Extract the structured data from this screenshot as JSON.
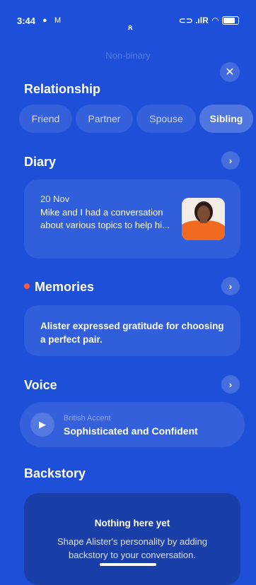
{
  "status_bar": {
    "time": "3:44",
    "right_text": "⊂⊃ .ılR"
  },
  "faded_value": "Non-binary",
  "relationship": {
    "heading": "Relationship",
    "options": [
      "Friend",
      "Partner",
      "Spouse",
      "Sibling"
    ],
    "selected": "Sibling"
  },
  "diary": {
    "heading": "Diary",
    "date": "20 Nov",
    "line1": "Mike and I had a conversation",
    "line2": "about various topics to help hi..."
  },
  "memories": {
    "heading": "Memories",
    "line1": "Alister expressed gratitude for choosing",
    "line2": "a perfect pair."
  },
  "voice": {
    "heading": "Voice",
    "accent": "British Accent",
    "name": "Sophisticated and Confident"
  },
  "backstory": {
    "heading": "Backstory",
    "empty_title": "Nothing here yet",
    "empty_line1": "Shape Alister's personality by adding",
    "empty_line2": "backstory to your conversation."
  },
  "colors": {
    "background": "#1d4fd8",
    "unread_dot": "#ff5a3c"
  }
}
